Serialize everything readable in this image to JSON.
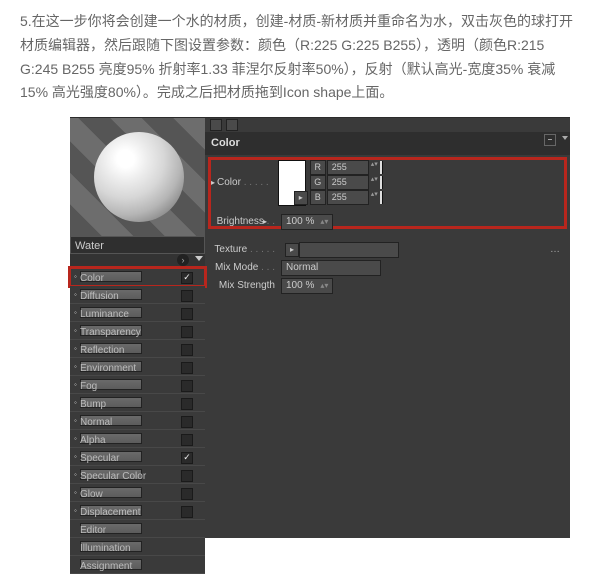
{
  "instruction": "5.在这一步你将会创建一个水的材质，创建-材质-新材质并重命名为水，双击灰色的球打开材质编辑器，然后跟随下图设置参数：颜色（R:225 G:225 B255），透明（颜色R:215 G:245 B255 亮度95% 折射率1.33 菲涅尔反射率50%），反射（默认高光-宽度35% 衰减15% 高光强度80%）。完成之后把材质拖到Icon shape上面。",
  "material_name": "Water",
  "properties": [
    {
      "label": "Color",
      "checked": true,
      "highlight": true
    },
    {
      "label": "Diffusion",
      "checked": false
    },
    {
      "label": "Luminance",
      "checked": false
    },
    {
      "label": "Transparency",
      "checked": false
    },
    {
      "label": "Reflection",
      "checked": false
    },
    {
      "label": "Environment",
      "checked": false
    },
    {
      "label": "Fog",
      "checked": false
    },
    {
      "label": "Bump",
      "checked": false
    },
    {
      "label": "Normal",
      "checked": false
    },
    {
      "label": "Alpha",
      "checked": false
    },
    {
      "label": "Specular",
      "checked": true
    },
    {
      "label": "Specular Color",
      "checked": false
    },
    {
      "label": "Glow",
      "checked": false
    },
    {
      "label": "Displacement",
      "checked": false
    },
    {
      "label": "Editor",
      "nolead": true
    },
    {
      "label": "Illumination",
      "nolead": true
    },
    {
      "label": "Assignment",
      "nolead": true
    }
  ],
  "color": {
    "title": "Color",
    "field_label": "Color",
    "r_label": "R",
    "g_label": "G",
    "b_label": "B",
    "r": "255",
    "g": "255",
    "b": "255",
    "brightness_label": "Brightness",
    "brightness": "100 %",
    "texture_label": "Texture",
    "texture_value": "",
    "mixmode_label": "Mix Mode",
    "mixmode": "Normal",
    "mixstrength_label": "Mix Strength",
    "mixstrength": "100 %"
  }
}
